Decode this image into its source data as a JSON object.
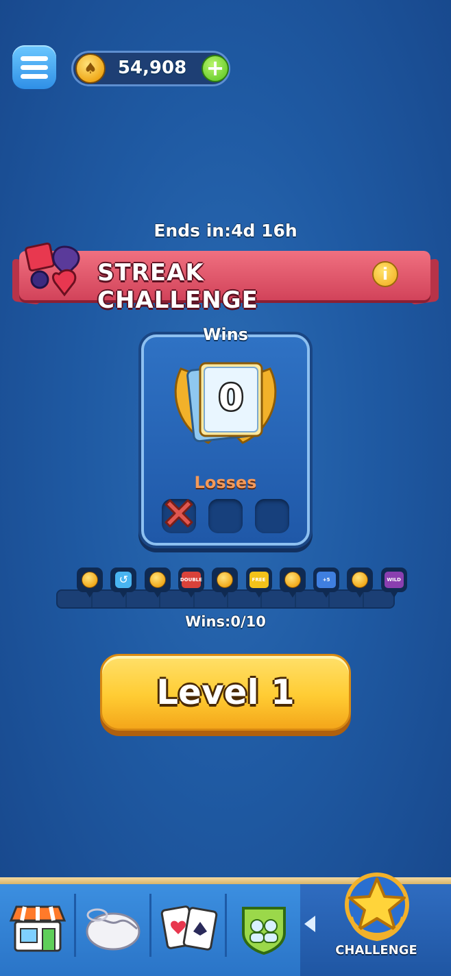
{
  "header": {
    "coins": "54,908"
  },
  "event": {
    "ends_in": "Ends in:4d 16h",
    "title": "STREAK CHALLENGE"
  },
  "panel": {
    "wins_label": "Wins",
    "wins_count": "0",
    "losses_label": "Losses",
    "losses_used": 1,
    "losses_total": 3
  },
  "progress": {
    "rewards": [
      {
        "icon": "coin-icon"
      },
      {
        "icon": "undo-icon"
      },
      {
        "icon": "coin-icon"
      },
      {
        "icon": "double-icon",
        "label": "DOUBLE"
      },
      {
        "icon": "coin-icon"
      },
      {
        "icon": "free-ticket-icon",
        "label": "FREE"
      },
      {
        "icon": "coin-icon"
      },
      {
        "icon": "plus-cards-icon",
        "label": "+5"
      },
      {
        "icon": "coin-icon"
      },
      {
        "icon": "wild-card-icon",
        "label": "WILD"
      }
    ],
    "wins_text": "Wins:0/10",
    "wins": 0,
    "total": 10
  },
  "play_button": {
    "label": "Level 1"
  },
  "nav": {
    "items": [
      {
        "icon": "shop-icon"
      },
      {
        "icon": "handshake-icon"
      },
      {
        "icon": "cards-icon"
      },
      {
        "icon": "friends-icon"
      }
    ],
    "active_label": "CHALLENGE"
  },
  "colors": {
    "background": "#1f5aa3",
    "ribbon": "#e05568",
    "play_button": "#ffcc33"
  }
}
